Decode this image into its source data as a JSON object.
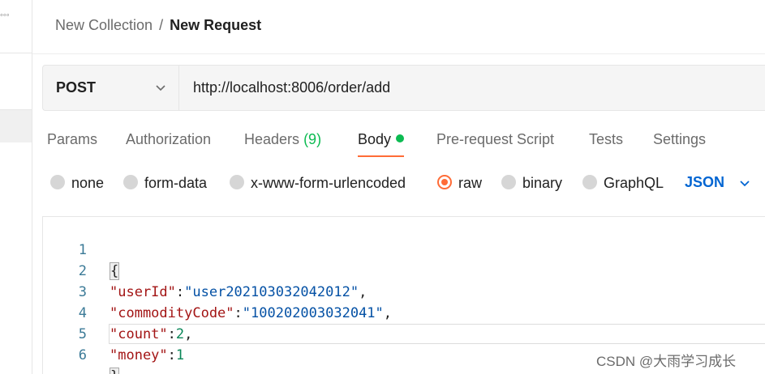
{
  "breadcrumb": {
    "parent": "New Collection",
    "separator": "/",
    "current": "New Request"
  },
  "request": {
    "method": "POST",
    "url": "http://localhost:8006/order/add"
  },
  "tabs": [
    {
      "label": "Params"
    },
    {
      "label": "Authorization"
    },
    {
      "label": "Headers",
      "count": "(9)"
    },
    {
      "label": "Body"
    },
    {
      "label": "Pre-request Script"
    },
    {
      "label": "Tests"
    },
    {
      "label": "Settings"
    }
  ],
  "active_tab": "Body",
  "body_modes": [
    {
      "label": "none",
      "checked": false
    },
    {
      "label": "form-data",
      "checked": false
    },
    {
      "label": "x-www-form-urlencoded",
      "checked": false
    },
    {
      "label": "raw",
      "checked": true
    },
    {
      "label": "binary",
      "checked": false
    },
    {
      "label": "GraphQL",
      "checked": false
    }
  ],
  "raw_format": "JSON",
  "editor": {
    "lines": [
      {
        "num": "1",
        "open": "{"
      },
      {
        "num": "2",
        "key": "\"userId\"",
        "colon": ":",
        "value": "\"user202103032042012\"",
        "comma": ","
      },
      {
        "num": "3",
        "key": "\"commodityCode\"",
        "colon": ":",
        "value": "\"100202003032041\"",
        "comma": ","
      },
      {
        "num": "4",
        "key": "\"count\"",
        "colon": ":",
        "number": "2",
        "comma": ","
      },
      {
        "num": "5",
        "key": "\"money\"",
        "colon": ":",
        "number": "1"
      },
      {
        "num": "6",
        "close": "}"
      }
    ]
  },
  "watermark": "CSDN @大雨学习成长",
  "colors": {
    "accent": "#ff6c37",
    "success": "#0cbb52",
    "link": "#0265d2",
    "json_key": "#a31515",
    "json_string": "#0451a5",
    "json_number": "#098658"
  }
}
